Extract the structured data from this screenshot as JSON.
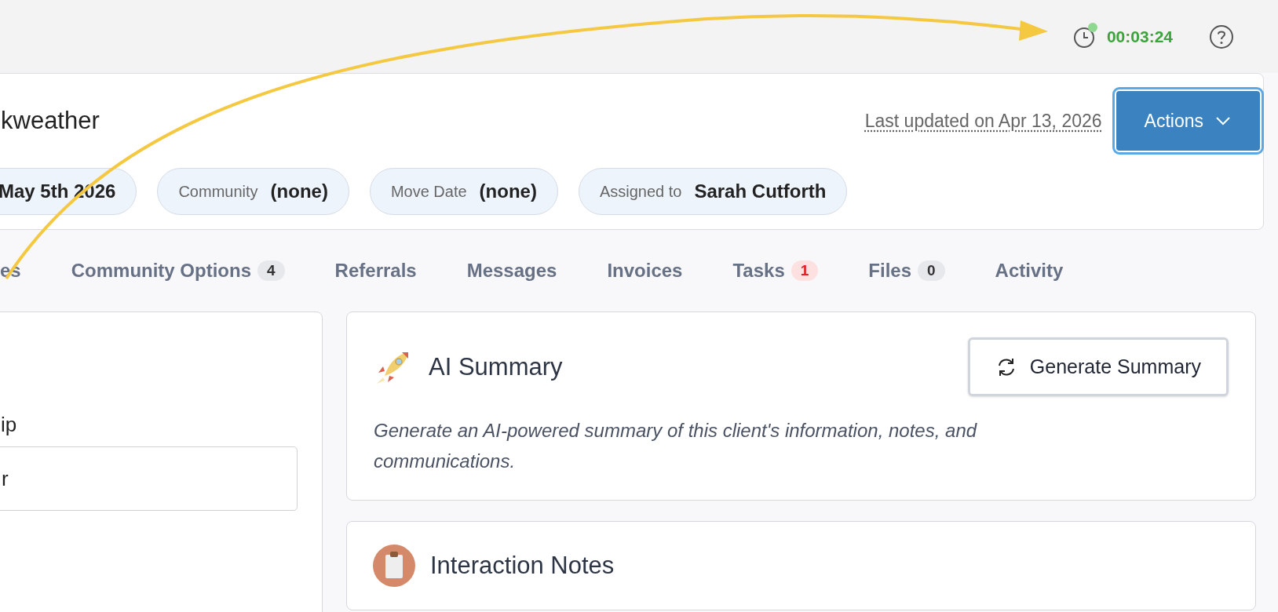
{
  "top_bar": {
    "timer": {
      "running": true,
      "time": "00:03:24"
    }
  },
  "header": {
    "title": "kweather",
    "last_updated": "Last updated on Apr 13, 2026",
    "actions_button": "Actions",
    "chips": [
      {
        "value": "May 5th 2026"
      },
      {
        "label": "Community",
        "value": "(none)"
      },
      {
        "label": "Move Date",
        "value": "(none)"
      },
      {
        "label": "Assigned to",
        "value": "Sarah Cutforth"
      }
    ]
  },
  "tabs": [
    {
      "label": "es",
      "selected": false
    },
    {
      "label": "Community Options",
      "selected": false,
      "badge": {
        "text": "4",
        "kind": "neutral"
      }
    },
    {
      "label": "Referrals",
      "selected": false
    },
    {
      "label": "Messages",
      "selected": false
    },
    {
      "label": "Invoices",
      "selected": false
    },
    {
      "label": "Tasks",
      "selected": false,
      "badge": {
        "text": "1",
        "kind": "alert"
      }
    },
    {
      "label": "Files",
      "selected": false,
      "badge": {
        "text": "0",
        "kind": "neutral"
      }
    },
    {
      "label": "Activity",
      "selected": false
    }
  ],
  "left_card": {
    "field_label": "ip",
    "field_value": "r"
  },
  "ai_summary": {
    "title": "AI Summary",
    "button": "Generate Summary",
    "description": "Generate an AI-powered summary of this client's information, notes, and communications."
  },
  "interaction_notes": {
    "title": "Interaction Notes"
  }
}
